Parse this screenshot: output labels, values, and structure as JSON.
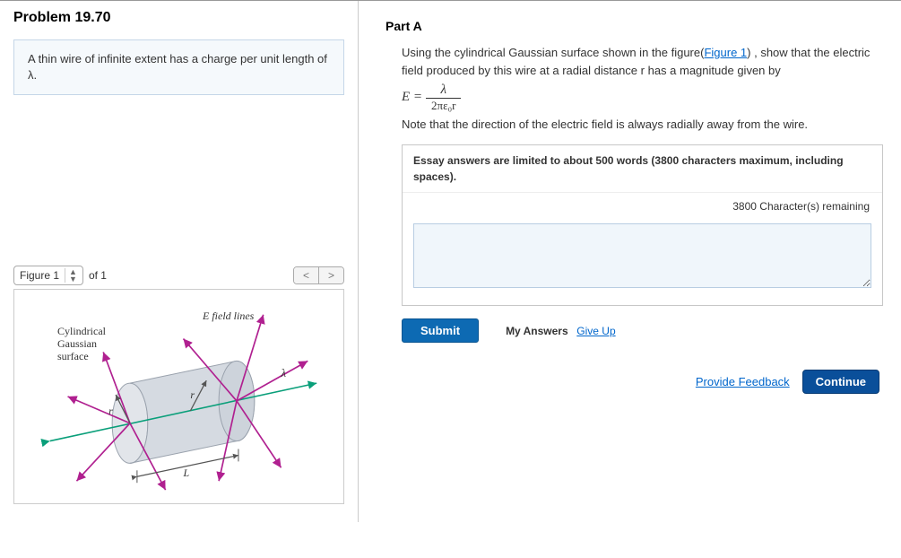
{
  "problem": {
    "title": "Problem 19.70"
  },
  "intro": {
    "text": "A thin wire of infinite extent has a charge per unit length of λ."
  },
  "figure": {
    "selector_label": "Figure 1",
    "of_text": "of 1",
    "prev": "<",
    "next": ">",
    "e_field_lines_label": "E field lines",
    "cyl_label_l1": "Cylindrical",
    "cyl_label_l2": "Gaussian",
    "cyl_label_l3": "surface",
    "r_label": "r",
    "lambda_label": "λ",
    "L_label": "L"
  },
  "partA": {
    "heading": "Part A",
    "line1_pre": "Using the cylindrical Gaussian surface shown in the figure(",
    "fig_link": "Figure 1",
    "line1_post": ") , show that the electric field produced by this wire at a radial distance r has a magnitude given by",
    "formula_lhs": "E =",
    "formula_num": "λ",
    "formula_den": "2πε₀r",
    "note": "Note that the direction of the electric field is always radially away from the wire."
  },
  "answer": {
    "limit_text": "Essay answers are limited to about 500 words (3800 characters maximum, including spaces).",
    "remaining": "3800 Character(s) remaining",
    "placeholder": ""
  },
  "actions": {
    "submit": "Submit",
    "my_answers": "My Answers",
    "give_up": "Give Up"
  },
  "footer": {
    "provide_feedback": "Provide Feedback",
    "continue": "Continue"
  }
}
